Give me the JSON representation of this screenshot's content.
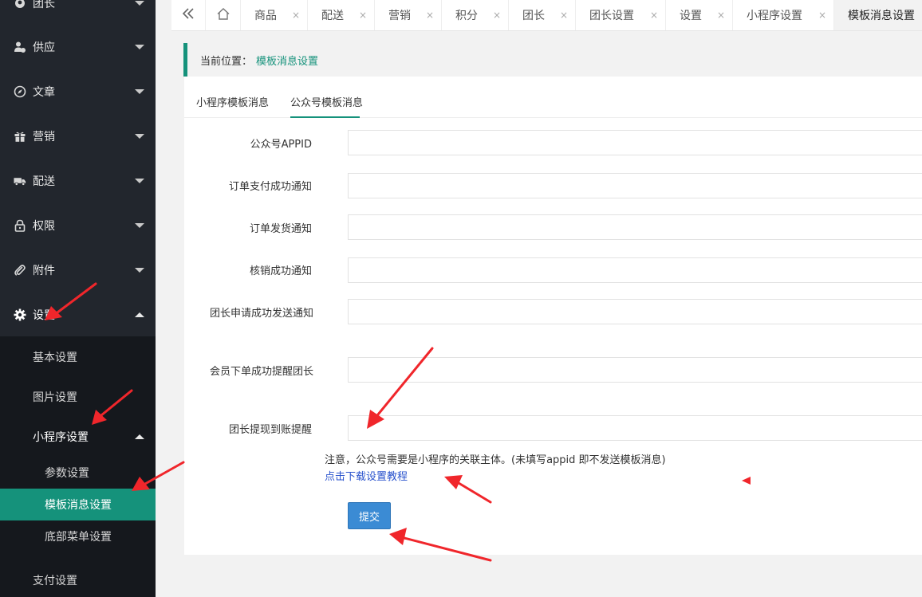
{
  "sidebar": {
    "items": [
      {
        "label": "团长",
        "icon": "team-icon",
        "expanded": false
      },
      {
        "label": "供应",
        "icon": "supplier-icon",
        "expanded": false
      },
      {
        "label": "文章",
        "icon": "compass-icon",
        "expanded": false
      },
      {
        "label": "营销",
        "icon": "gift-icon",
        "expanded": false
      },
      {
        "label": "配送",
        "icon": "truck-icon",
        "expanded": false
      },
      {
        "label": "权限",
        "icon": "lock-icon",
        "expanded": false
      },
      {
        "label": "附件",
        "icon": "paperclip-icon",
        "expanded": false
      },
      {
        "label": "设置",
        "icon": "gear-icon",
        "expanded": true
      }
    ],
    "settings_sub": [
      "基本设置",
      "图片设置",
      "小程序设置",
      "支付设置"
    ],
    "miniprogram_sub": [
      "参数设置",
      "模板消息设置",
      "底部菜单设置"
    ],
    "active_item": "模板消息设置",
    "accent": "#15927b"
  },
  "tabs": {
    "collapse_icon": "double-chevron-left-icon",
    "home_icon": "home-icon",
    "items": [
      "商品",
      "配送",
      "营销",
      "积分",
      "团长",
      "团长设置",
      "设置",
      "小程序设置",
      "模板消息设置"
    ],
    "close_glyph": "×",
    "active": "模板消息设置"
  },
  "breadcrumb": {
    "prefix": "当前位置：",
    "current": "模板消息设置"
  },
  "panel_tabs": {
    "items": [
      "小程序模板消息",
      "公众号模板消息"
    ],
    "active": "公众号模板消息"
  },
  "form": {
    "fields": [
      {
        "label": "公众号APPID",
        "value": ""
      },
      {
        "label": "订单支付成功通知",
        "value": ""
      },
      {
        "label": "订单发货通知",
        "value": ""
      },
      {
        "label": "核销成功通知",
        "value": ""
      },
      {
        "label": "团长申请成功发送通知",
        "value": ""
      },
      {
        "label": "会员下单成功提醒团长",
        "value": ""
      },
      {
        "label": "团长提现到账提醒",
        "value": ""
      }
    ],
    "note": "注意，公众号需要是小程序的关联主体。(未填写appid 即不发送模板消息)",
    "download_link": "点击下载设置教程",
    "submit_label": "提交"
  },
  "colors": {
    "sidebar_bg": "#22262d",
    "submenu_bg": "#15181d",
    "annotation_red": "#f0262b",
    "link_blue": "#2a53cd",
    "submit_blue": "#3b8bd4"
  }
}
